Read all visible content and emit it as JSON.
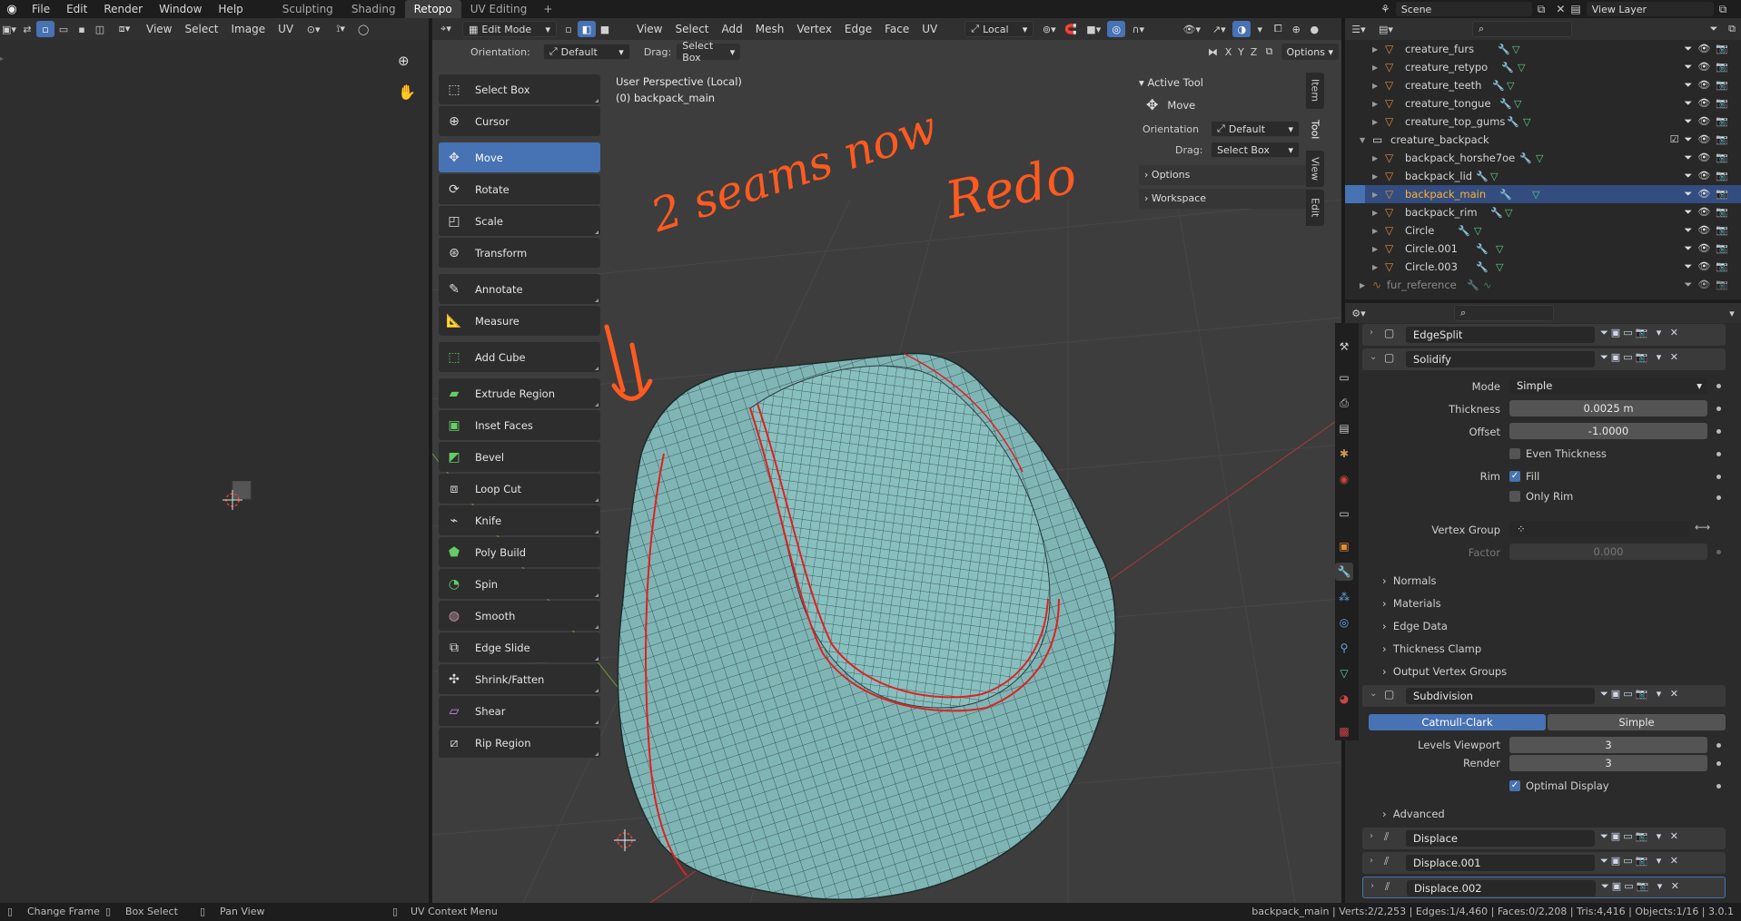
{
  "topbar": {
    "menus": [
      "File",
      "Edit",
      "Render",
      "Window",
      "Help"
    ],
    "workspaces": [
      "Sculpting",
      "Shading",
      "Retopo",
      "UV Editing"
    ],
    "active_workspace": "Retopo",
    "scene": "Scene",
    "view_layer": "View Layer"
  },
  "uv_editor": {
    "menus": [
      "View",
      "Select",
      "Image",
      "UV"
    ]
  },
  "viewport": {
    "mode": "Edit Mode",
    "menus": [
      "View",
      "Select",
      "Add",
      "Mesh",
      "Vertex",
      "Edge",
      "Face",
      "UV"
    ],
    "transform_orientation": "Local",
    "orientation_label": "Orientation:",
    "orientation_value": "Default",
    "drag_label": "Drag:",
    "drag_value": "Select Box",
    "axes": [
      "X",
      "Y",
      "Z"
    ],
    "options_label": "Options",
    "overlay_title": "User Perspective (Local)",
    "overlay_object": "(0) backpack_main",
    "annotation_text_1": "2 seams now",
    "annotation_text_2": "Redo",
    "side_tabs": [
      "Item",
      "Tool",
      "View",
      "Edit"
    ],
    "active_side_tab": "Tool"
  },
  "active_tool_panel": {
    "title": "Active Tool",
    "tool_name": "Move",
    "orientation_label": "Orientation",
    "orientation_value": "Default",
    "drag_label": "Drag:",
    "drag_value": "Select Box",
    "options_label": "Options",
    "workspace_label": "Workspace"
  },
  "tools": [
    {
      "label": "Select Box",
      "icon": "select-box-icon",
      "active": false
    },
    {
      "label": "Cursor",
      "icon": "cursor-icon",
      "active": false
    },
    {
      "label": "Move",
      "icon": "move-icon",
      "active": true
    },
    {
      "label": "Rotate",
      "icon": "rotate-icon",
      "active": false
    },
    {
      "label": "Scale",
      "icon": "scale-icon",
      "active": false
    },
    {
      "label": "Transform",
      "icon": "transform-icon",
      "active": false
    },
    {
      "label": "Annotate",
      "icon": "annotate-icon",
      "active": false
    },
    {
      "label": "Measure",
      "icon": "measure-icon",
      "active": false
    },
    {
      "label": "Add Cube",
      "icon": "add-cube-icon",
      "active": false
    },
    {
      "label": "Extrude Region",
      "icon": "extrude-icon",
      "active": false
    },
    {
      "label": "Inset Faces",
      "icon": "inset-icon",
      "active": false
    },
    {
      "label": "Bevel",
      "icon": "bevel-icon",
      "active": false
    },
    {
      "label": "Loop Cut",
      "icon": "loop-cut-icon",
      "active": false
    },
    {
      "label": "Knife",
      "icon": "knife-icon",
      "active": false
    },
    {
      "label": "Poly Build",
      "icon": "poly-build-icon",
      "active": false
    },
    {
      "label": "Spin",
      "icon": "spin-icon",
      "active": false
    },
    {
      "label": "Smooth",
      "icon": "smooth-icon",
      "active": false
    },
    {
      "label": "Edge Slide",
      "icon": "edge-slide-icon",
      "active": false
    },
    {
      "label": "Shrink/Fatten",
      "icon": "shrink-fatten-icon",
      "active": false
    },
    {
      "label": "Shear",
      "icon": "shear-icon",
      "active": false
    },
    {
      "label": "Rip Region",
      "icon": "rip-region-icon",
      "active": false
    }
  ],
  "outliner": {
    "rows": [
      {
        "name": "creature_furs",
        "selected": false
      },
      {
        "name": "creature_retypo",
        "selected": false
      },
      {
        "name": "creature_teeth",
        "selected": false
      },
      {
        "name": "creature_tongue",
        "selected": false
      },
      {
        "name": "creature_top_gums",
        "selected": false
      },
      {
        "name": "creature_backpack",
        "selected": false,
        "collection": true
      },
      {
        "name": "backpack_horshe7oe",
        "selected": false
      },
      {
        "name": "backpack_lid",
        "selected": false
      },
      {
        "name": "backpack_main",
        "selected": true
      },
      {
        "name": "backpack_rim",
        "selected": false
      },
      {
        "name": "Circle",
        "selected": false
      },
      {
        "name": "Circle.001",
        "selected": false
      },
      {
        "name": "Circle.003",
        "selected": false
      },
      {
        "name": "fur_reference",
        "selected": false,
        "dim": true
      }
    ]
  },
  "properties": {
    "edgesplit_name": "EdgeSplit",
    "solidify_name": "Solidify",
    "mode_label": "Mode",
    "mode_value": "Simple",
    "thickness_label": "Thickness",
    "thickness_value": "0.0025 m",
    "offset_label": "Offset",
    "offset_value": "-1.0000",
    "even_thickness_label": "Even Thickness",
    "rim_label": "Rim",
    "fill_label": "Fill",
    "only_rim_label": "Only Rim",
    "vertex_group_label": "Vertex Group",
    "factor_label": "Factor",
    "factor_value": "0.000",
    "sections": [
      "Normals",
      "Materials",
      "Edge Data",
      "Thickness Clamp",
      "Output Vertex Groups"
    ],
    "subdivision_name": "Subdivision",
    "catmull_clark_label": "Catmull-Clark",
    "simple_label": "Simple",
    "levels_viewport_label": "Levels Viewport",
    "levels_viewport_value": "3",
    "render_label": "Render",
    "render_value": "3",
    "optimal_display_label": "Optimal Display",
    "advanced_label": "Advanced",
    "displace_names": [
      "Displace",
      "Displace.001",
      "Displace.002"
    ]
  },
  "statusbar": {
    "left_items": [
      "Change Frame",
      "Box Select",
      "Pan View"
    ],
    "uv_context": "UV Context Menu",
    "stats": "backpack_main | Verts:2/2,253 | Edges:1/4,460 | Faces:0/2,208 | Tris:4,416 | Objects:1/16 | 3.0.1"
  },
  "colors": {
    "accent": "#4772b3",
    "annotation": "#ff5a1f",
    "mesh": "#7fb5b5",
    "seam": "#e02020"
  }
}
